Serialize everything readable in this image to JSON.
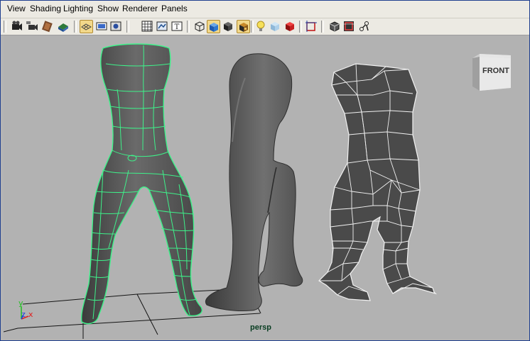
{
  "menu": [
    "View",
    "Shading",
    "Lighting",
    "Show",
    "Renderer",
    "Panels"
  ],
  "toolbar": {
    "icons": [
      "select-camera-icon",
      "camera-attributes-icon",
      "bookmark-icon",
      "image-plane-icon",
      "grid-icon",
      "film-gate-icon",
      "resolution-gate-icon",
      "field-chart-icon",
      "safe-action-icon",
      "safe-title-icon",
      "wireframe-icon",
      "smooth-shade-icon",
      "default-material-icon",
      "textured-icon",
      "use-all-lights-icon",
      "shadows-icon",
      "high-quality-icon",
      "isolate-select-icon",
      "xray-icon",
      "wireframe-on-shaded-icon",
      "xray-joints-icon"
    ]
  },
  "viewport": {
    "camera_label": "persp",
    "view_cube_label": "FRONT",
    "axis_labels": {
      "y": "y",
      "z": "z",
      "x": "x"
    },
    "colors": {
      "background": "#b2b2b2",
      "wireframe_selected": "#3ef28a",
      "mesh": "#5a5a5a",
      "axis_x": "#e02020",
      "axis_y": "#20c020",
      "axis_z": "#2040e0"
    }
  }
}
